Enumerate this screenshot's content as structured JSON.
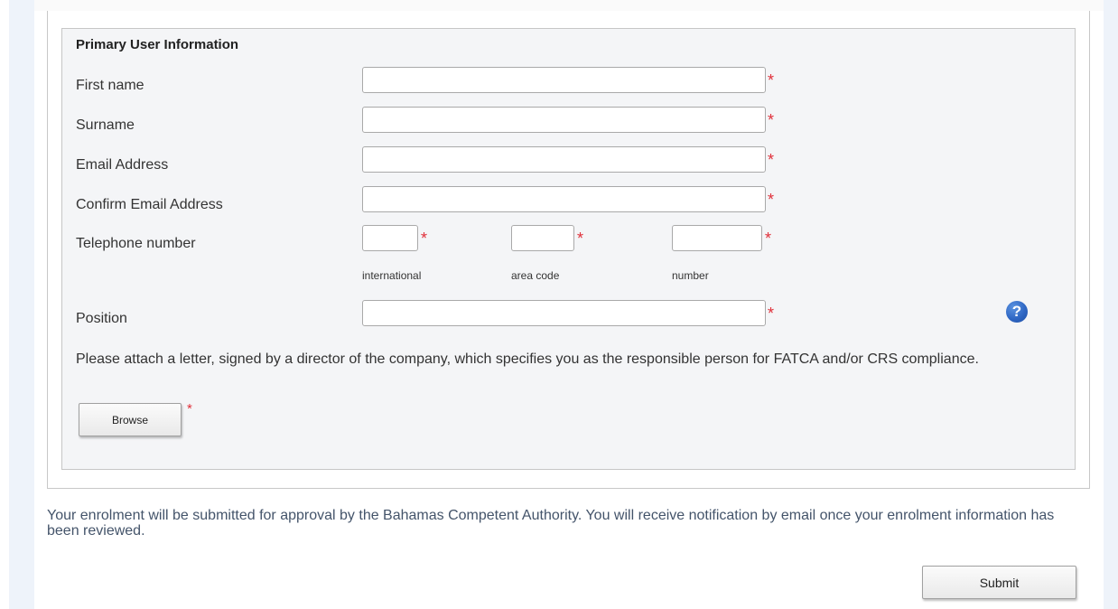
{
  "section": {
    "title": "Primary User Information"
  },
  "fields": {
    "first_name": {
      "label": "First name",
      "value": ""
    },
    "surname": {
      "label": "Surname",
      "value": ""
    },
    "email": {
      "label": "Email Address",
      "value": ""
    },
    "confirm_email": {
      "label": "Confirm Email Address",
      "value": ""
    },
    "telephone": {
      "label": "Telephone number",
      "international_label": "international",
      "area_code_label": "area code",
      "number_label": "number",
      "international_value": "",
      "area_code_value": "",
      "number_value": ""
    },
    "position": {
      "label": "Position",
      "value": ""
    }
  },
  "required_marker": "*",
  "help_icon_glyph": "?",
  "attachment": {
    "instructions": "Please attach a letter, signed by a director of the company, which specifies you as the responsible person for FATCA and/or CRS compliance.",
    "browse_label": "Browse"
  },
  "notice": "Your enrolment will be submitted for approval by the Bahamas Competent Authority. You will receive notification by email once your enrolment information has been reviewed.",
  "submit_label": "Submit",
  "colors": {
    "required": "#e0303a",
    "help_icon": "#2f67c4",
    "notice_text": "#44546a",
    "fieldset_bg": "#f4f5f7"
  }
}
